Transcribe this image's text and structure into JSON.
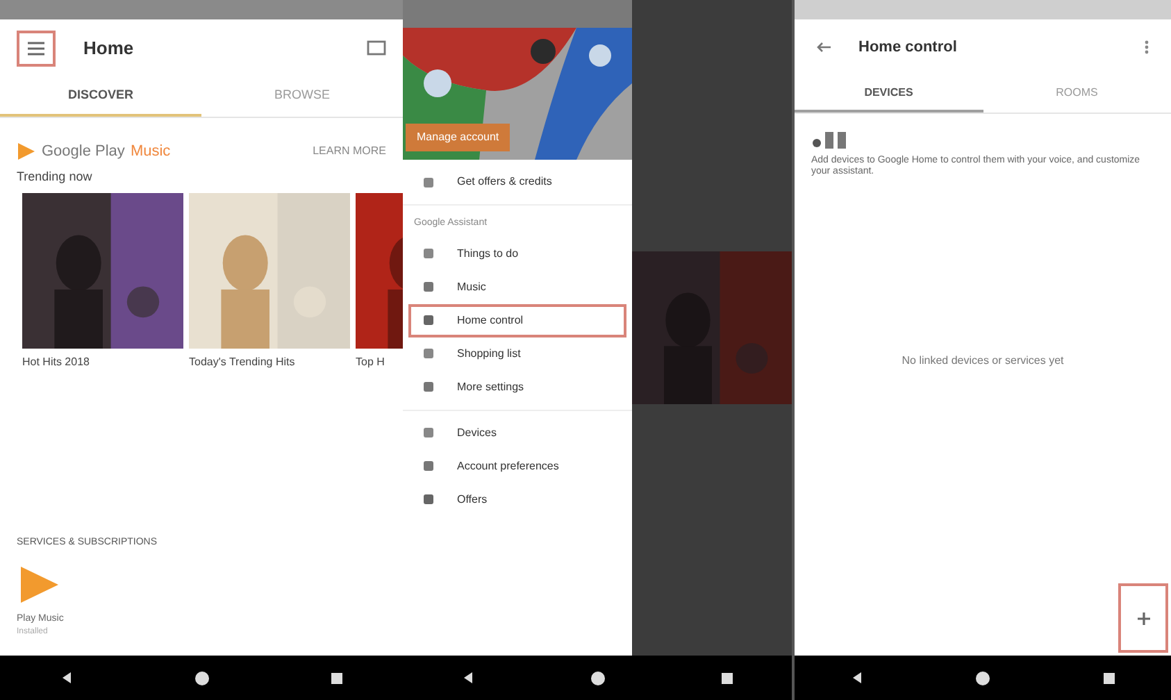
{
  "home_screen": {
    "title": "Home",
    "menu_highlighted": true,
    "tabs": [
      {
        "label": "DISCOVER",
        "selected": true
      },
      {
        "label": "BROWSE",
        "selected": false
      }
    ],
    "banner": {
      "brand": "Google Play",
      "product": "Music",
      "action": "LEARN MORE"
    },
    "section_title": "Trending now",
    "cards": [
      {
        "title": "Hot Hits 2018"
      },
      {
        "title": "Today's Trending Hits"
      },
      {
        "title": "Top H"
      }
    ],
    "services_title": "SERVICES & SUBSCRIPTIONS",
    "service": {
      "name": "Play Music",
      "status": "Installed"
    }
  },
  "drawer_screen": {
    "account_action": "Manage account",
    "sections": [
      {
        "items": [
          {
            "label": "Get offers & credits",
            "highlighted": false
          }
        ]
      },
      {
        "title": "Google Assistant",
        "items": [
          {
            "label": "Things to do",
            "highlighted": false
          },
          {
            "label": "Music",
            "highlighted": false
          },
          {
            "label": "Home control",
            "highlighted": true
          },
          {
            "label": "Shopping list",
            "highlighted": false
          },
          {
            "label": "More settings",
            "highlighted": false
          }
        ]
      },
      {
        "items": [
          {
            "label": "Devices",
            "highlighted": false
          },
          {
            "label": "Account preferences",
            "highlighted": false
          },
          {
            "label": "Offers",
            "highlighted": false
          }
        ]
      }
    ]
  },
  "home_control_screen": {
    "title": "Home control",
    "tabs": [
      {
        "label": "DEVICES",
        "selected": true
      },
      {
        "label": "ROOMS",
        "selected": false
      }
    ],
    "description": "Add devices to Google Home to control them with your voice, and customize your assistant.",
    "empty_message": "No linked devices or services yet",
    "fab_highlighted": true
  }
}
